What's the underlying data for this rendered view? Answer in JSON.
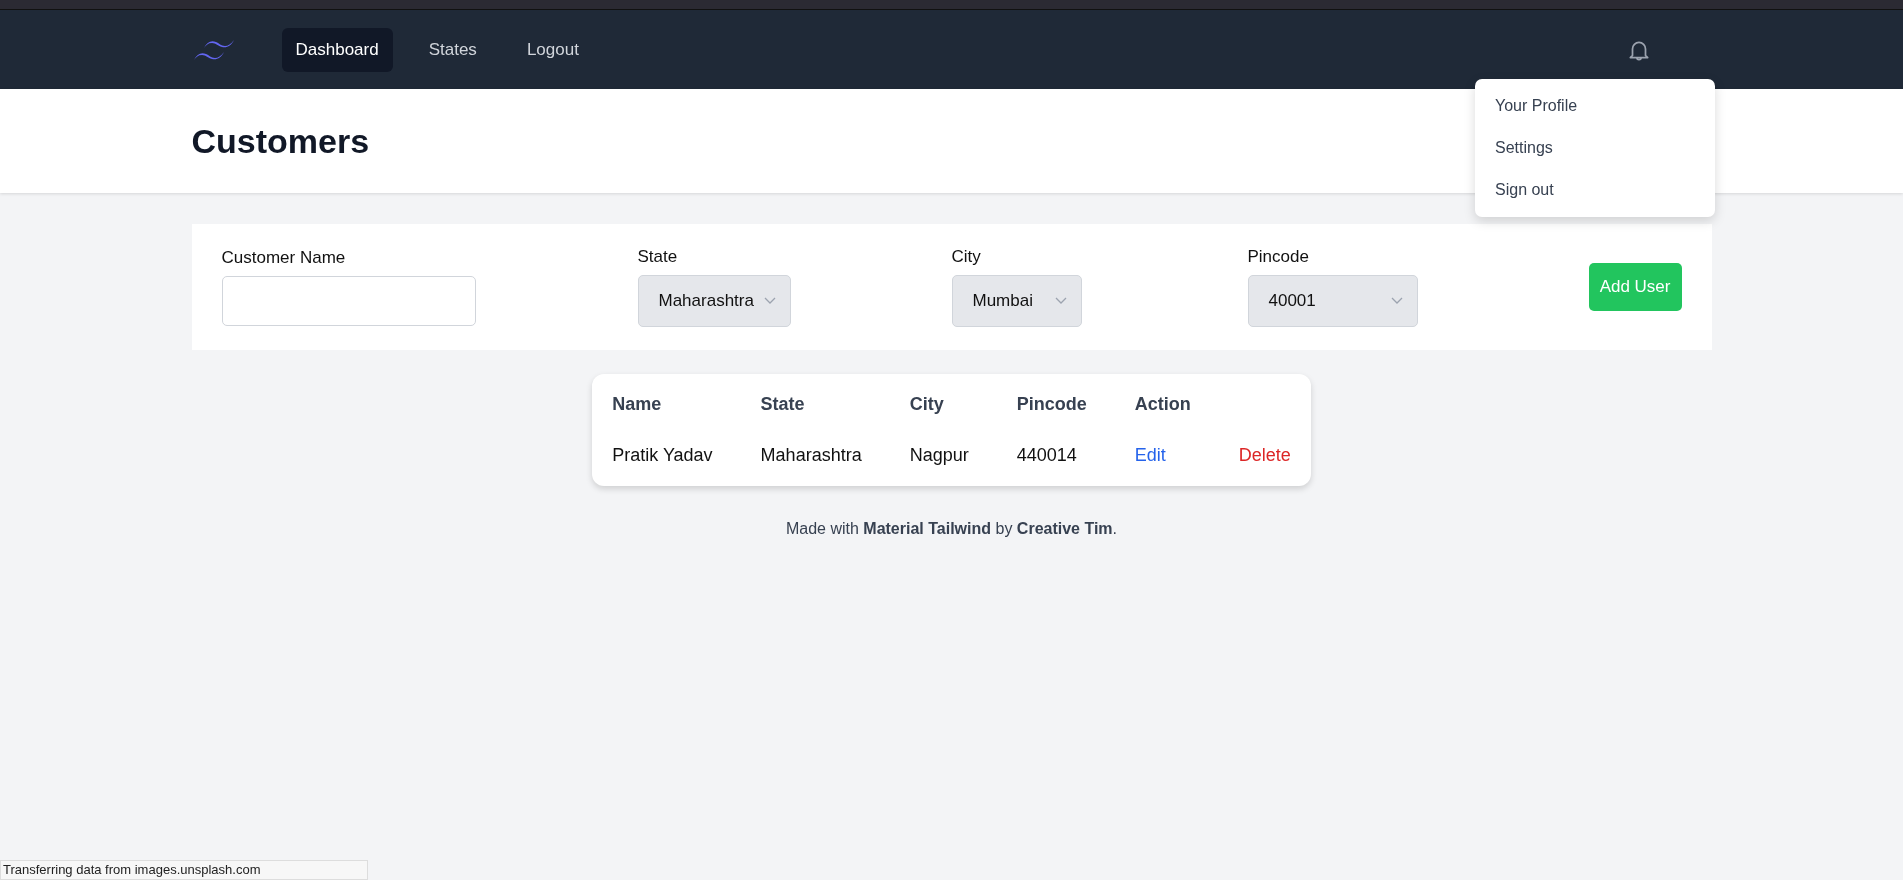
{
  "nav": {
    "items": [
      {
        "label": "Dashboard",
        "selected": true
      },
      {
        "label": "States",
        "selected": false
      },
      {
        "label": "Logout",
        "selected": false
      }
    ]
  },
  "profile_menu": {
    "items": [
      "Your Profile",
      "Settings",
      "Sign out"
    ]
  },
  "header": {
    "title": "Customers"
  },
  "filters": {
    "fields": [
      {
        "kind": "text",
        "label": "Customer Name"
      },
      {
        "kind": "select",
        "label": "State",
        "value": "Maharashtra"
      },
      {
        "kind": "select",
        "label": "City",
        "value": "Mumbai"
      },
      {
        "kind": "select",
        "label": "Pincode",
        "value": "40001"
      }
    ],
    "button": "Add User"
  },
  "table": {
    "columns": [
      "Name",
      "State",
      "City",
      "Pincode",
      "Action"
    ],
    "rows": [
      {
        "name": "Pratik Yadav",
        "state": "Maharashtra",
        "city": "Nagpur",
        "pincode": "440014",
        "edit": "Edit",
        "delete": "Delete"
      }
    ]
  },
  "footer": "Made with **Material Tailwind** by **Creative Tim**.",
  "status_bar": "Transferring data from images.unsplash.com"
}
